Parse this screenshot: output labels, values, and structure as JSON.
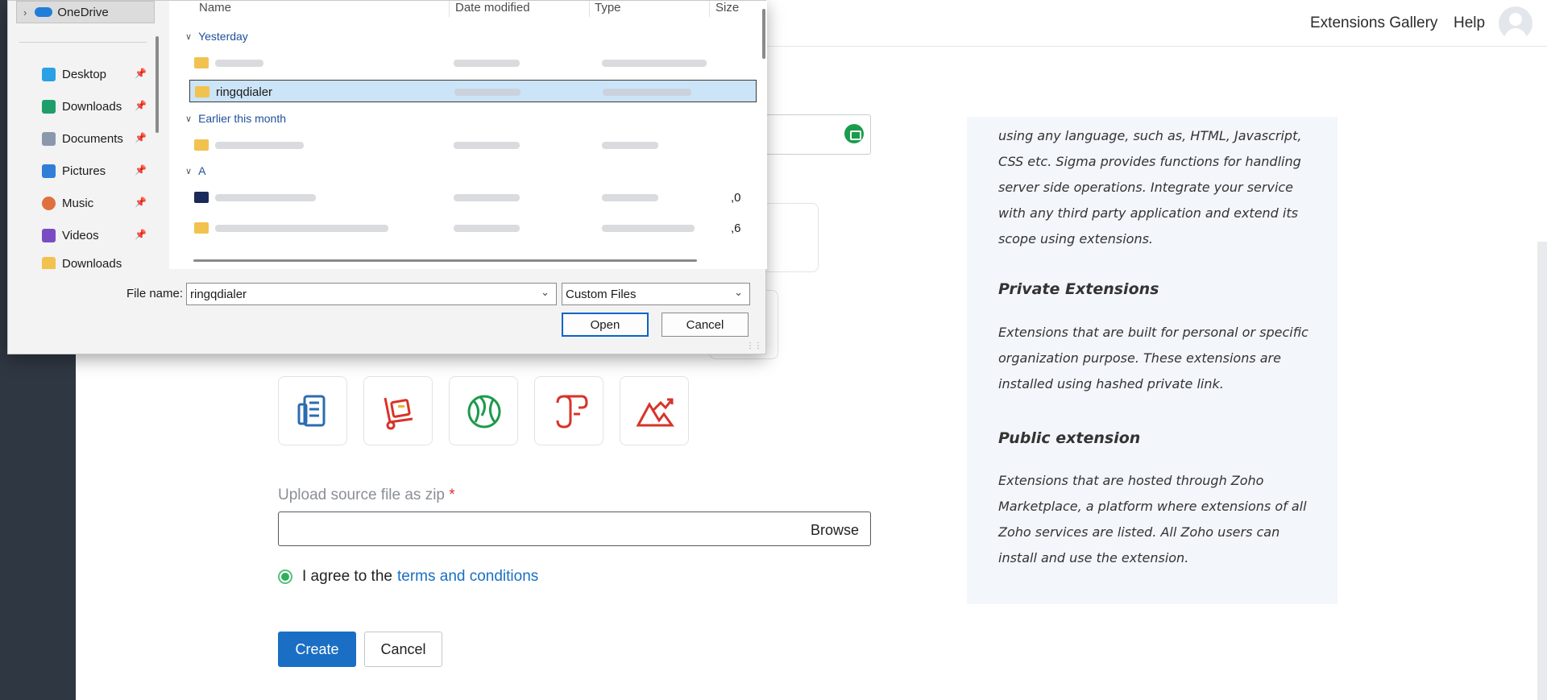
{
  "header": {
    "gallery_label": "Extensions Gallery",
    "help_label": "Help"
  },
  "form": {
    "upload_label": "Upload source file as zip",
    "required_mark": "*",
    "browse_label": "Browse",
    "agree_text": "I agree to the",
    "terms_link": "terms and conditions",
    "create_label": "Create",
    "cancel_label": "Cancel"
  },
  "info": {
    "intro": "using any language, such as, HTML, Javascript, CSS etc. Sigma provides functions for handling server side operations. Integrate your service with any third party application and extend its scope using extensions.",
    "private_title": "Private Extensions",
    "private_text": "Extensions that are built for personal or specific organization purpose. These extensions are installed using hashed private link.",
    "public_title": "Public extension",
    "public_text": "Extensions that are hosted through Zoho Marketplace, a platform where extensions of all Zoho services are listed. All Zoho users can install and use the extension."
  },
  "icons": [
    "document-icon",
    "hand-truck-icon",
    "globe-icon",
    "scroll-icon",
    "mountain-chart-icon"
  ],
  "dialog": {
    "nav": {
      "onedrive": "OneDrive",
      "items": [
        {
          "label": "Desktop",
          "color": "#2aa0e6"
        },
        {
          "label": "Downloads",
          "color": "#1e9e6a"
        },
        {
          "label": "Documents",
          "color": "#8a98ab"
        },
        {
          "label": "Pictures",
          "color": "#2f7fd8"
        },
        {
          "label": "Music",
          "color": "#e0703c"
        },
        {
          "label": "Videos",
          "color": "#7a4cc4"
        },
        {
          "label": "Downloads",
          "color": "#f2c24f"
        }
      ]
    },
    "columns": {
      "name": "Name",
      "date": "Date modified",
      "type": "Type",
      "size": "Size"
    },
    "groups": {
      "yesterday": "Yesterday",
      "earlier": "Earlier this month",
      "long_ago": "A"
    },
    "selected_file": "ringqdialer",
    "file_name_label": "File name:",
    "file_name_value": "ringqdialer",
    "file_type_value": "Custom Files",
    "open_label": "Open",
    "cancel_label": "Cancel",
    "size_fragment_1": ",0",
    "size_fragment_2": ",6"
  }
}
